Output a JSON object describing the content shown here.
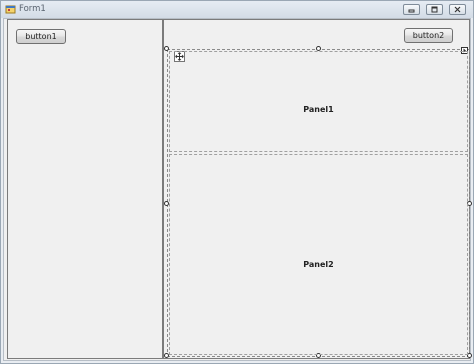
{
  "window": {
    "title": "Form1"
  },
  "buttons": {
    "button1": "button1",
    "button2": "button2"
  },
  "panels": {
    "panel1": "Panel1",
    "panel2": "Panel2"
  },
  "icons": {
    "app": "form-icon",
    "minimize": "minimize-icon",
    "maximize": "maximize-icon",
    "close": "close-icon",
    "move": "move-handle-icon",
    "smart_tag": "smart-tag-icon"
  }
}
